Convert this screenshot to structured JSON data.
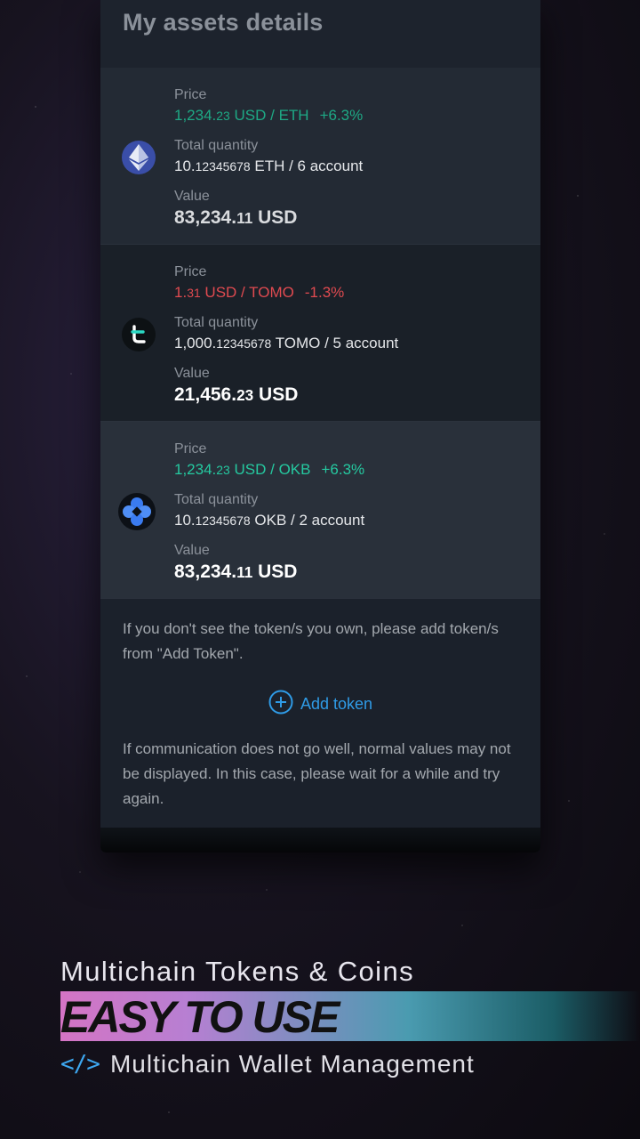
{
  "header": {
    "title": "My assets details"
  },
  "assets": [
    {
      "price_label": "Price",
      "price_main": "1,234.",
      "price_small": "23",
      "price_unit": " USD / ETH",
      "change": "+6.3%",
      "qty_label": "Total quantity",
      "qty_main": "10.",
      "qty_small": "12345678",
      "qty_unit": " ETH / 6 account",
      "value_label": "Value",
      "value_main": "83,234.",
      "value_small": "11",
      "value_unit": " USD",
      "icon": "ethereum-icon",
      "trend": "up"
    },
    {
      "price_label": "Price",
      "price_main": "1.",
      "price_small": "31",
      "price_unit": " USD / TOMO",
      "change": "-1.3%",
      "qty_label": "Total quantity",
      "qty_main": "1,000.",
      "qty_small": "12345678",
      "qty_unit": " TOMO / 5 account",
      "value_label": "Value",
      "value_main": "21,456.",
      "value_small": "23",
      "value_unit": " USD",
      "icon": "tomochain-icon",
      "trend": "down"
    },
    {
      "price_label": "Price",
      "price_main": "1,234.",
      "price_small": "23",
      "price_unit": " USD / OKB",
      "change": "+6.3%",
      "qty_label": "Total quantity",
      "qty_main": "10.",
      "qty_small": "12345678",
      "qty_unit": " OKB / 2 account",
      "value_label": "Value",
      "value_main": "83,234.",
      "value_small": "11",
      "value_unit": " USD",
      "icon": "okb-icon",
      "trend": "up"
    }
  ],
  "notes": {
    "add_token_hint": "If you don't see the token/s you own, please add token/s from \"Add Token\".",
    "add_token_label": "Add token",
    "communication_hint": "If communication does not go well, normal values may not be displayed. In this case, please wait for a while and try again."
  },
  "promo": {
    "headline": "Multichain Tokens & Coins",
    "banner": "EASY TO USE",
    "code_symbol": "</>",
    "subline": "Multichain Wallet Management"
  },
  "colors": {
    "positive": "#1ea985",
    "negative": "#e04a50",
    "link": "#2f9be6",
    "scroll_indicator": "#e05cd0"
  }
}
